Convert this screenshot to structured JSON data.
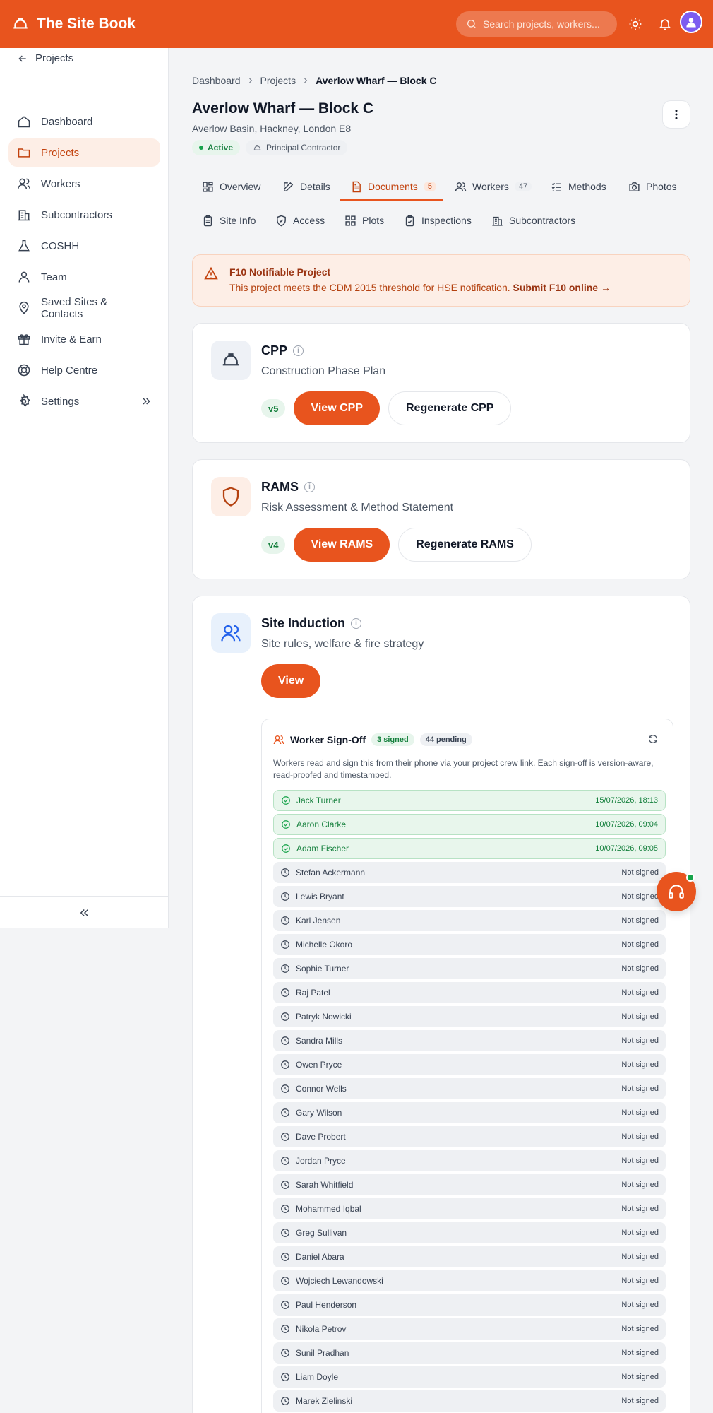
{
  "header": {
    "brand": "The Site Book",
    "search_placeholder": "Search projects, workers..."
  },
  "sidebar": {
    "back_label": "Projects",
    "items": [
      {
        "label": "Dashboard",
        "icon": "home-icon"
      },
      {
        "label": "Projects",
        "icon": "folder-icon",
        "active": true
      },
      {
        "label": "Workers",
        "icon": "users-icon"
      },
      {
        "label": "Subcontractors",
        "icon": "building-icon"
      },
      {
        "label": "COSHH",
        "icon": "flask-icon"
      },
      {
        "label": "Team",
        "icon": "user-icon"
      },
      {
        "label": "Saved Sites & Contacts",
        "icon": "map-pin-icon"
      },
      {
        "label": "Invite & Earn",
        "icon": "gift-icon"
      },
      {
        "label": "Help Centre",
        "icon": "lifebuoy-icon"
      },
      {
        "label": "Settings",
        "icon": "gear-icon"
      }
    ]
  },
  "breadcrumb": [
    "Dashboard",
    "Projects",
    "Averlow Wharf — Block C"
  ],
  "project": {
    "title": "Averlow Wharf — Block C",
    "address": "Averlow Basin, Hackney, London E8",
    "status": "Active",
    "role": "Principal Contractor"
  },
  "tabs": [
    {
      "label": "Overview",
      "icon": "grid-icon"
    },
    {
      "label": "Details",
      "icon": "edit-icon"
    },
    {
      "label": "Documents",
      "icon": "document-icon",
      "count": "5",
      "active": true
    },
    {
      "label": "Workers",
      "icon": "users-icon",
      "count": "47"
    },
    {
      "label": "Methods",
      "icon": "checklist-icon"
    },
    {
      "label": "Photos",
      "icon": "camera-icon"
    },
    {
      "label": "Site Info",
      "icon": "clipboard-icon"
    },
    {
      "label": "Access",
      "icon": "shield-check-icon"
    },
    {
      "label": "Plots",
      "icon": "grid-icon"
    },
    {
      "label": "Inspections",
      "icon": "clipboard-check-icon"
    },
    {
      "label": "Subcontractors",
      "icon": "building-icon"
    }
  ],
  "alert": {
    "title": "F10 Notifiable Project",
    "text": "This project meets the CDM 2015 threshold for HSE notification.",
    "link": "Submit F10 online →"
  },
  "cards": {
    "cpp": {
      "title": "CPP",
      "subtitle": "Construction Phase Plan",
      "version": "v5",
      "primary": "View CPP",
      "secondary": "Regenerate CPP"
    },
    "rams": {
      "title": "RAMS",
      "subtitle": "Risk Assessment & Method Statement",
      "version": "v4",
      "primary": "View RAMS",
      "secondary": "Regenerate RAMS"
    },
    "induction": {
      "title": "Site Induction",
      "subtitle": "Site rules, welfare & fire strategy",
      "primary": "View"
    }
  },
  "signoff": {
    "title": "Worker Sign-Off",
    "signed_count": "3 signed",
    "pending_count": "44 pending",
    "description": "Workers read and sign this from their phone via your project crew link. Each sign-off is version-aware, read-proofed and timestamped.",
    "workers": [
      {
        "name": "Jack Turner",
        "status": "15/07/2026, 18:13",
        "signed": true
      },
      {
        "name": "Aaron Clarke",
        "status": "10/07/2026, 09:04",
        "signed": true
      },
      {
        "name": "Adam Fischer",
        "status": "10/07/2026, 09:05",
        "signed": true
      },
      {
        "name": "Stefan Ackermann",
        "status": "Not signed",
        "signed": false
      },
      {
        "name": "Lewis Bryant",
        "status": "Not signed",
        "signed": false
      },
      {
        "name": "Karl Jensen",
        "status": "Not signed",
        "signed": false
      },
      {
        "name": "Michelle Okoro",
        "status": "Not signed",
        "signed": false
      },
      {
        "name": "Sophie Turner",
        "status": "Not signed",
        "signed": false
      },
      {
        "name": "Raj Patel",
        "status": "Not signed",
        "signed": false
      },
      {
        "name": "Patryk Nowicki",
        "status": "Not signed",
        "signed": false
      },
      {
        "name": "Sandra Mills",
        "status": "Not signed",
        "signed": false
      },
      {
        "name": "Owen Pryce",
        "status": "Not signed",
        "signed": false
      },
      {
        "name": "Connor Wells",
        "status": "Not signed",
        "signed": false
      },
      {
        "name": "Gary Wilson",
        "status": "Not signed",
        "signed": false
      },
      {
        "name": "Dave Probert",
        "status": "Not signed",
        "signed": false
      },
      {
        "name": "Jordan Pryce",
        "status": "Not signed",
        "signed": false
      },
      {
        "name": "Sarah Whitfield",
        "status": "Not signed",
        "signed": false
      },
      {
        "name": "Mohammed Iqbal",
        "status": "Not signed",
        "signed": false
      },
      {
        "name": "Greg Sullivan",
        "status": "Not signed",
        "signed": false
      },
      {
        "name": "Daniel Abara",
        "status": "Not signed",
        "signed": false
      },
      {
        "name": "Wojciech Lewandowski",
        "status": "Not signed",
        "signed": false
      },
      {
        "name": "Paul Henderson",
        "status": "Not signed",
        "signed": false
      },
      {
        "name": "Nikola Petrov",
        "status": "Not signed",
        "signed": false
      },
      {
        "name": "Sunil Pradhan",
        "status": "Not signed",
        "signed": false
      },
      {
        "name": "Liam Doyle",
        "status": "Not signed",
        "signed": false
      },
      {
        "name": "Marek Zielinski",
        "status": "Not signed",
        "signed": false
      }
    ]
  },
  "colors": {
    "brand": "#e8541e",
    "success": "#15803d"
  }
}
